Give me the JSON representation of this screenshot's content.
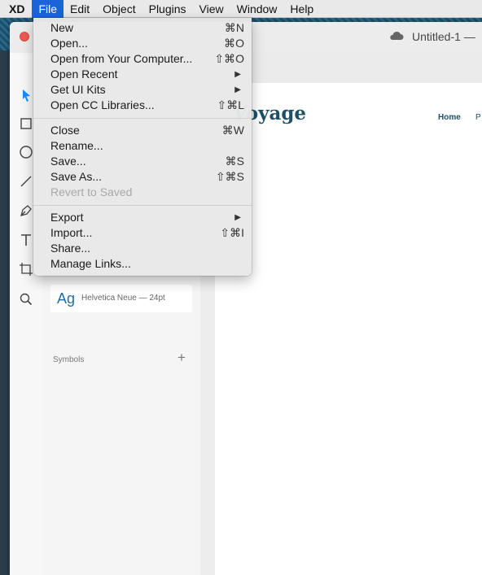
{
  "menubar": {
    "app": "XD",
    "items": [
      "File",
      "Edit",
      "Object",
      "Plugins",
      "View",
      "Window",
      "Help"
    ],
    "active_index": 0
  },
  "window": {
    "doc_title": "Untitled-1 —",
    "cloud_icon": "cloud-icon"
  },
  "assets": {
    "char_style_sample": "Ag",
    "char_style_desc": "Helvetica Neue — 24pt",
    "symbols_label": "Symbols",
    "symbols_add": "+"
  },
  "canvas": {
    "brand": "Voyage",
    "nav_home": "Home",
    "nav_next": "P"
  },
  "file_menu": {
    "groups": [
      [
        {
          "label": "New",
          "shortcut": "⌘N"
        },
        {
          "label": "Open...",
          "shortcut": "⌘O"
        },
        {
          "label": "Open from Your Computer...",
          "shortcut": "⇧⌘O"
        },
        {
          "label": "Open Recent",
          "submenu": true
        },
        {
          "label": "Get UI Kits",
          "submenu": true
        },
        {
          "label": "Open CC Libraries...",
          "shortcut": "⇧⌘L"
        }
      ],
      [
        {
          "label": "Close",
          "shortcut": "⌘W"
        },
        {
          "label": "Rename..."
        },
        {
          "label": "Save...",
          "shortcut": "⌘S"
        },
        {
          "label": "Save As...",
          "shortcut": "⇧⌘S"
        },
        {
          "label": "Revert to Saved",
          "disabled": true
        }
      ],
      [
        {
          "label": "Export",
          "submenu": true
        },
        {
          "label": "Import...",
          "shortcut": "⇧⌘I"
        },
        {
          "label": "Share..."
        },
        {
          "label": "Manage Links..."
        }
      ]
    ]
  },
  "colors": {
    "menubar_active": "#1a63d8",
    "close_button": "#ee5a52",
    "brand_text": "#1d5066",
    "select_tool": "#1a8cff"
  }
}
